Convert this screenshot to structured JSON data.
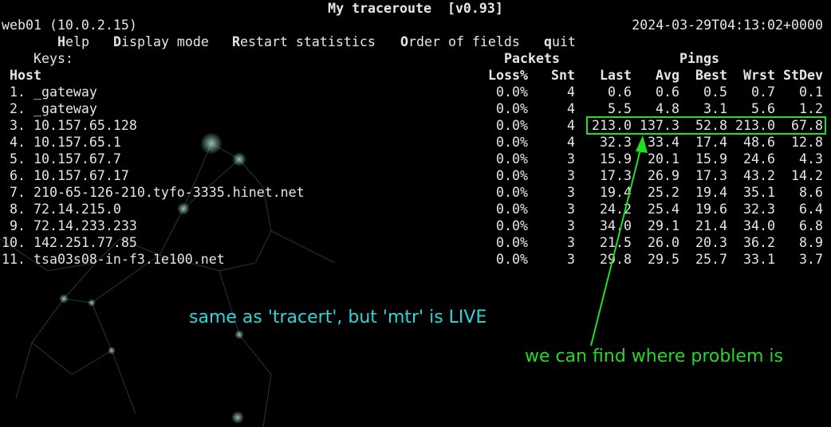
{
  "window": {
    "title": "My traceroute  [v0.93]",
    "host_info": "web01 (10.0.2.15)",
    "timestamp": "2024-03-29T04:13:02+0000"
  },
  "keys": {
    "prefix": "Keys:",
    "items": [
      {
        "key": "H",
        "rest": "elp"
      },
      {
        "key": "D",
        "rest": "isplay mode"
      },
      {
        "key": "R",
        "rest": "estart statistics"
      },
      {
        "key": "O",
        "rest": "rder of fields"
      },
      {
        "key": "q",
        "rest": "uit"
      }
    ]
  },
  "table": {
    "group_packets": "Packets",
    "group_pings": "Pings",
    "host_header": "Host",
    "columns": [
      "Loss%",
      "Snt",
      "Last",
      "Avg",
      "Best",
      "Wrst",
      "StDev"
    ],
    "rows": [
      {
        "num": " 1.",
        "host": "_gateway",
        "loss": "0.0%",
        "snt": "4",
        "last": "0.6",
        "avg": "0.6",
        "best": "0.5",
        "wrst": "0.7",
        "stdev": "0.1"
      },
      {
        "num": " 2.",
        "host": "_gateway",
        "loss": "0.0%",
        "snt": "4",
        "last": "5.5",
        "avg": "4.8",
        "best": "3.1",
        "wrst": "5.6",
        "stdev": "1.2"
      },
      {
        "num": " 3.",
        "host": "10.157.65.128",
        "loss": "0.0%",
        "snt": "4",
        "last": "213.0",
        "avg": "137.3",
        "best": "52.8",
        "wrst": "213.0",
        "stdev": "67.8"
      },
      {
        "num": " 4.",
        "host": "10.157.65.1",
        "loss": "0.0%",
        "snt": "4",
        "last": "32.3",
        "avg": "33.4",
        "best": "17.4",
        "wrst": "48.6",
        "stdev": "12.8"
      },
      {
        "num": " 5.",
        "host": "10.157.67.7",
        "loss": "0.0%",
        "snt": "3",
        "last": "15.9",
        "avg": "20.1",
        "best": "15.9",
        "wrst": "24.6",
        "stdev": "4.3"
      },
      {
        "num": " 6.",
        "host": "10.157.67.17",
        "loss": "0.0%",
        "snt": "3",
        "last": "17.3",
        "avg": "26.9",
        "best": "17.3",
        "wrst": "43.2",
        "stdev": "14.2"
      },
      {
        "num": " 7.",
        "host": "210-65-126-210.tyfo-3335.hinet.net",
        "loss": "0.0%",
        "snt": "3",
        "last": "19.4",
        "avg": "25.2",
        "best": "19.4",
        "wrst": "35.1",
        "stdev": "8.6"
      },
      {
        "num": " 8.",
        "host": "72.14.215.0",
        "loss": "0.0%",
        "snt": "3",
        "last": "24.2",
        "avg": "25.4",
        "best": "19.6",
        "wrst": "32.3",
        "stdev": "6.4"
      },
      {
        "num": " 9.",
        "host": "72.14.233.233",
        "loss": "0.0%",
        "snt": "3",
        "last": "34.0",
        "avg": "29.1",
        "best": "21.4",
        "wrst": "34.0",
        "stdev": "6.8"
      },
      {
        "num": "10.",
        "host": "142.251.77.85",
        "loss": "0.0%",
        "snt": "3",
        "last": "21.5",
        "avg": "26.0",
        "best": "20.3",
        "wrst": "36.2",
        "stdev": "8.9"
      },
      {
        "num": "11.",
        "host": "tsa03s08-in-f3.1e100.net",
        "loss": "0.0%",
        "snt": "3",
        "last": "29.8",
        "avg": "29.5",
        "best": "25.7",
        "wrst": "33.1",
        "stdev": "3.7"
      }
    ]
  },
  "annotations": {
    "live_note": "same as 'tracert', but 'mtr' is LIVE",
    "problem_note": "we can find where problem is",
    "highlight_color": "#1fe11f",
    "live_note_color": "#2fd6d8",
    "problem_note_color": "#27d62b"
  }
}
